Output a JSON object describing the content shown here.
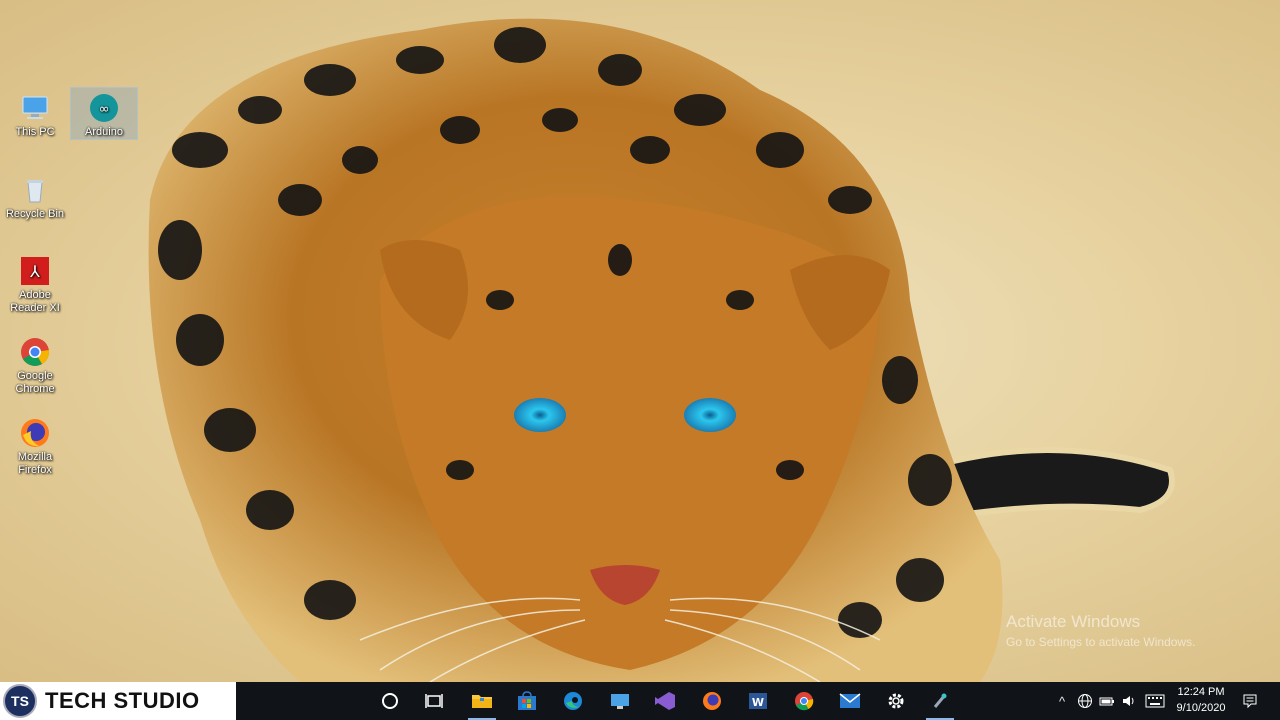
{
  "desktop": {
    "icons": [
      {
        "label": "This PC",
        "icon": "computer-icon"
      },
      {
        "label": "Arduino",
        "icon": "arduino-icon"
      },
      {
        "label": "Recycle Bin",
        "icon": "recycle-bin-icon"
      },
      {
        "label": "Adobe Reader XI",
        "icon": "adobe-reader-icon"
      },
      {
        "label": "Google Chrome",
        "icon": "chrome-icon"
      },
      {
        "label": "Mozilla Firefox",
        "icon": "firefox-icon"
      }
    ],
    "watermark": {
      "title": "Activate Windows",
      "subtitle": "Go to Settings to activate Windows."
    }
  },
  "branding": {
    "logo_text": "TS",
    "name": "TECH STUDIO"
  },
  "taskbar": {
    "pinned": [
      {
        "icon": "cortana-icon"
      },
      {
        "icon": "task-view-icon"
      },
      {
        "icon": "file-explorer-icon"
      },
      {
        "icon": "microsoft-store-icon"
      },
      {
        "icon": "edge-icon"
      },
      {
        "icon": "remote-desktop-icon"
      },
      {
        "icon": "visual-studio-icon"
      },
      {
        "icon": "firefox-icon"
      },
      {
        "icon": "word-icon"
      },
      {
        "icon": "chrome-icon"
      },
      {
        "icon": "mail-icon"
      },
      {
        "icon": "settings-gear-icon"
      },
      {
        "icon": "arduino-icon"
      }
    ],
    "clock": {
      "time": "12:24 PM",
      "date": "9/10/2020"
    }
  },
  "colors": {
    "taskbar": "#101418",
    "accent": "#8fb8ea"
  }
}
